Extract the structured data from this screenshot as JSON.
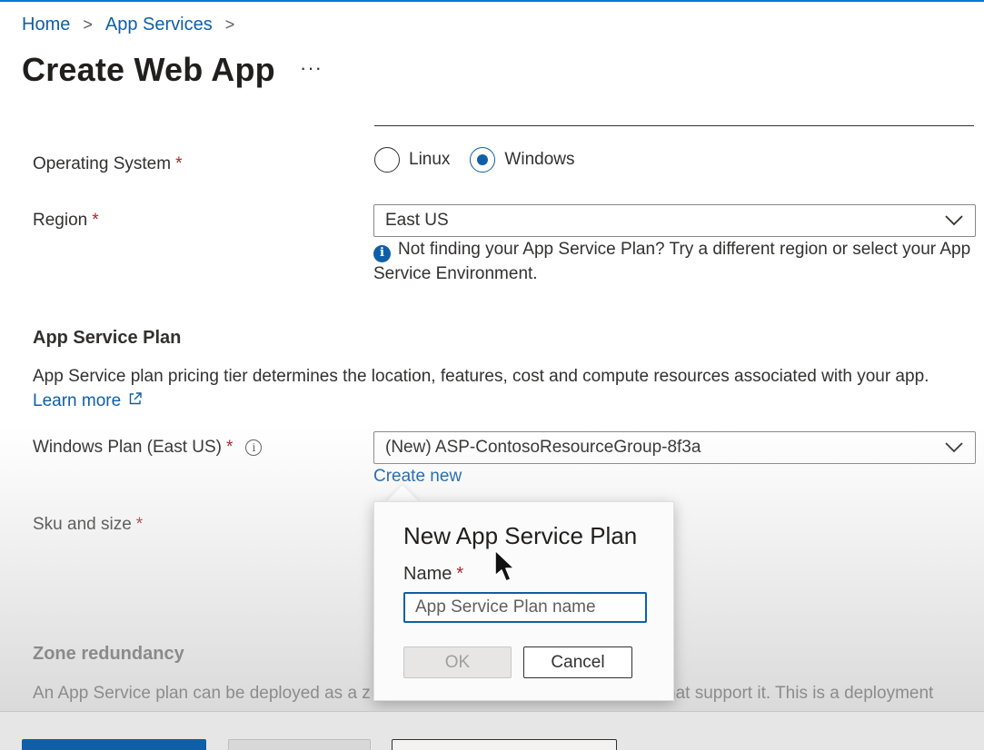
{
  "breadcrumb": {
    "items": [
      "Home",
      "App Services"
    ],
    "separator": ">"
  },
  "page": {
    "title": "Create Web App",
    "more_label": "···"
  },
  "os": {
    "label": "Operating System",
    "required_mark": "*",
    "options": [
      "Linux",
      "Windows"
    ],
    "selected": "Windows"
  },
  "region": {
    "label": "Region",
    "required_mark": "*",
    "value": "East US",
    "info_text": "Not finding your App Service Plan? Try a different region or select your App Service Environment."
  },
  "plan_section": {
    "title": "App Service Plan",
    "description": "App Service plan pricing tier determines the location, features, cost and compute resources associated with your app.",
    "learn_more": "Learn more"
  },
  "windows_plan": {
    "label": "Windows Plan (East US)",
    "required_mark": "*",
    "value": "(New) ASP-ContosoResourceGroup-8f3a",
    "create_new": "Create new"
  },
  "sku": {
    "label": "Sku and size",
    "required_mark": "*"
  },
  "zone": {
    "title": "Zone redundancy",
    "description_left": "An App Service plan can be deployed as a z",
    "description_right": "hat support it. This is a deployment"
  },
  "dialog": {
    "title": "New App Service Plan",
    "name_label": "Name",
    "required_mark": "*",
    "name_placeholder": "App Service Plan name",
    "ok_label": "OK",
    "cancel_label": "Cancel"
  },
  "colors": {
    "accent": "#0f5fa8",
    "required": "#a4262c",
    "text": "#323130"
  }
}
